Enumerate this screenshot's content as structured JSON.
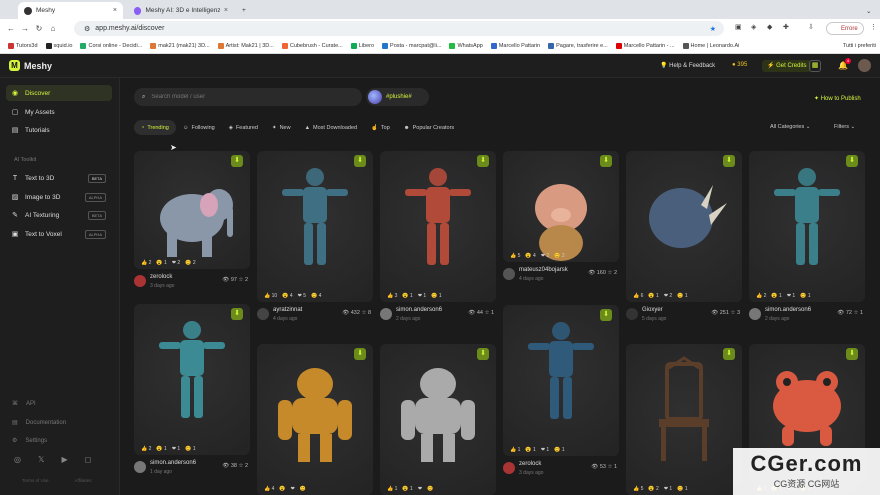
{
  "browser": {
    "tabs": [
      {
        "label": "Meshy"
      },
      {
        "label": "Meshy AI: 3D e Intelligenza Art"
      }
    ],
    "url": "app.meshy.ai/discover",
    "profile": "Errore",
    "bookmarks": [
      "Tutors3d",
      "squid.io",
      "Corsi online - Decidi...",
      "mak21 (mak21) 3D...",
      "Artist: Mak21 | 3D...",
      "Cubebrush - Curate...",
      "Libero",
      "Posta - marcpat@li...",
      "WhatsApp",
      "Marcello Pattarin",
      "Pagare, trasferire e...",
      "Marcello Pattarin - ...",
      "Home | Leonardo.Ai"
    ],
    "all_bookmarks": "Tutti i preferiti"
  },
  "appbar": {
    "logo": "Meshy",
    "help": "Help & Feedback",
    "credits": "395",
    "get_credits": "Get Credits",
    "notif_count": "4"
  },
  "sidebar": {
    "main": [
      {
        "label": "Discover"
      },
      {
        "label": "My Assets"
      },
      {
        "label": "Tutorials"
      }
    ],
    "toolkit_label": "AI Toolkit",
    "tools": [
      {
        "label": "Text to 3D",
        "tag": "BETA"
      },
      {
        "label": "Image to 3D",
        "tag": "ALPHA"
      },
      {
        "label": "AI Texturing",
        "tag": "BETA"
      },
      {
        "label": "Text to Voxel",
        "tag": "ALPHA"
      }
    ],
    "footer": [
      {
        "label": "API"
      },
      {
        "label": "Documentation"
      },
      {
        "label": "Settings"
      }
    ],
    "terms": "Terms of Use",
    "affiliates": "Affiliates"
  },
  "search": {
    "placeholder": "Search model / user"
  },
  "promo": {
    "label": "#plushie#"
  },
  "publish": "How to Publish",
  "filters": [
    {
      "label": "Trending"
    },
    {
      "label": "Following"
    },
    {
      "label": "Featured"
    },
    {
      "label": "New"
    },
    {
      "label": "Most Downloaded"
    },
    {
      "label": "Top"
    },
    {
      "label": "Popular Creators"
    }
  ],
  "all_categories": "All Categories",
  "filters_btn": "Filters",
  "cards": [
    {
      "user": "zerolock",
      "date": "3 days ago",
      "views": "97",
      "stars": "2",
      "reacts": [
        "2",
        "1",
        "2",
        "2"
      ],
      "color": "#a33"
    },
    {
      "user": "ayratzinnat",
      "date": "4 days ago",
      "views": "432",
      "stars": "8",
      "reacts": [
        "10",
        "4",
        "5",
        "4"
      ],
      "color": "#444"
    },
    {
      "user": "simon.anderson6",
      "date": "2 days ago",
      "views": "44",
      "stars": "1",
      "reacts": [
        "3",
        "1",
        "1",
        "1"
      ],
      "color": "#777"
    },
    {
      "user": "mateusz04bojarsk",
      "date": "4 days ago",
      "views": "160",
      "stars": "2",
      "reacts": [
        "5",
        "4",
        "2",
        "2"
      ],
      "color": "#555"
    },
    {
      "user": "Gioxyer",
      "date": "5 days ago",
      "views": "251",
      "stars": "3",
      "reacts": [
        "6",
        "1",
        "2",
        "1"
      ],
      "color": "#333"
    },
    {
      "user": "simon.anderson6",
      "date": "2 days ago",
      "views": "72",
      "stars": "1",
      "reacts": [
        "2",
        "1",
        "1",
        "1"
      ],
      "color": "#777"
    },
    {
      "user": "simon.anderson6",
      "date": "1 day ago",
      "views": "38",
      "stars": "2",
      "reacts": [
        "2",
        "1",
        "1",
        "1"
      ],
      "color": "#777"
    },
    {
      "user": "",
      "date": "",
      "views": "",
      "stars": "",
      "reacts": [
        "4",
        "",
        "",
        ""
      ],
      "color": "#444"
    },
    {
      "user": "",
      "date": "",
      "views": "",
      "stars": "",
      "reacts": [
        "1",
        "1",
        "",
        ""
      ],
      "color": "#444"
    },
    {
      "user": "zerolock",
      "date": "3 days ago",
      "views": "53",
      "stars": "1",
      "reacts": [
        "1",
        "1",
        "1",
        "1"
      ],
      "color": "#a33"
    },
    {
      "user": "",
      "date": "",
      "views": "",
      "stars": "",
      "reacts": [
        "5",
        "2",
        "1",
        "1"
      ],
      "color": "#444"
    },
    {
      "user": "",
      "date": "",
      "views": "",
      "stars": "",
      "reacts": [
        "1",
        "1",
        "1",
        "1"
      ],
      "color": "#444"
    }
  ],
  "watermark": {
    "main": "CGer.com",
    "sub": "CG资源 CG网站"
  }
}
